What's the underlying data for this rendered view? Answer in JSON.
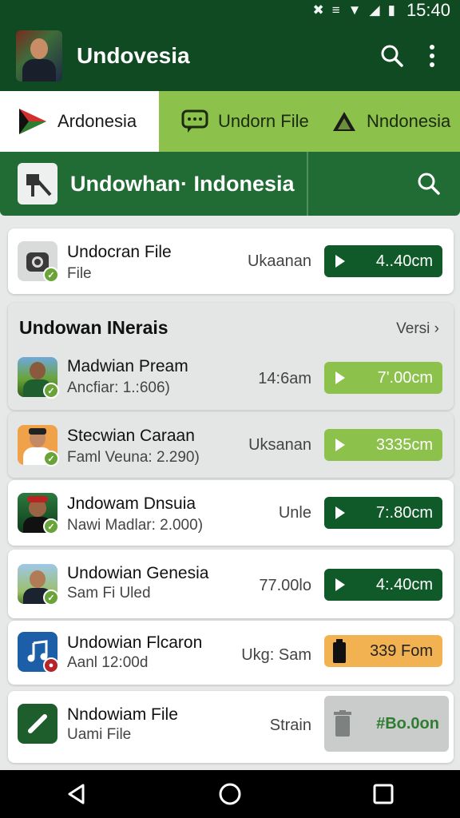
{
  "status": {
    "time": "15:40"
  },
  "appbar": {
    "title": "Undovesia",
    "search_icon": "search-icon",
    "menu_icon": "more-vert-icon"
  },
  "tabs": [
    {
      "label": "Ardonesia",
      "icon": "play-store-icon"
    },
    {
      "label": "Undorn File",
      "icon": "chat-icon"
    },
    {
      "label": "Nndonesia",
      "icon": "triangle-icon"
    }
  ],
  "search": {
    "title": "Undowhan· Indonesia",
    "icon": "search-icon"
  },
  "top_item": {
    "title": "Undocran File",
    "subtitle": "File",
    "meta": "Ukaanan",
    "action": "4..40cm"
  },
  "section": {
    "title": "Undowan INerais",
    "more": "Versi",
    "items": [
      {
        "title": "Madwian Pream",
        "subtitle": "Ancfiar: 1.:606)",
        "meta": "14:6am",
        "action": "7'.00cm"
      },
      {
        "title": "Stecwian Caraan",
        "subtitle": "Faml Veuna: 2.290)",
        "meta": "Uksanan",
        "action": "3335cm"
      }
    ]
  },
  "list": [
    {
      "title": "Jndowam Dnsuia",
      "subtitle": "Nawi Madlar: 2.000)",
      "meta": "Unle",
      "action": "7:.80cm"
    },
    {
      "title": "Undowian Genesia",
      "subtitle": "Sam Fi Uled",
      "meta": "77.00lo",
      "action": "4:.40cm"
    },
    {
      "title": "Undowian Flcaron",
      "subtitle": "Aanl 12:00d",
      "meta": "Ukg: Sam",
      "action": "339 Fom"
    },
    {
      "title": "Nndowiam File",
      "subtitle": "Uami File",
      "meta": "Strain",
      "action": "#Bo.0on"
    }
  ],
  "colors": {
    "primary": "#0f4a22",
    "accent": "#8cc14c",
    "orange": "#f3b251"
  }
}
